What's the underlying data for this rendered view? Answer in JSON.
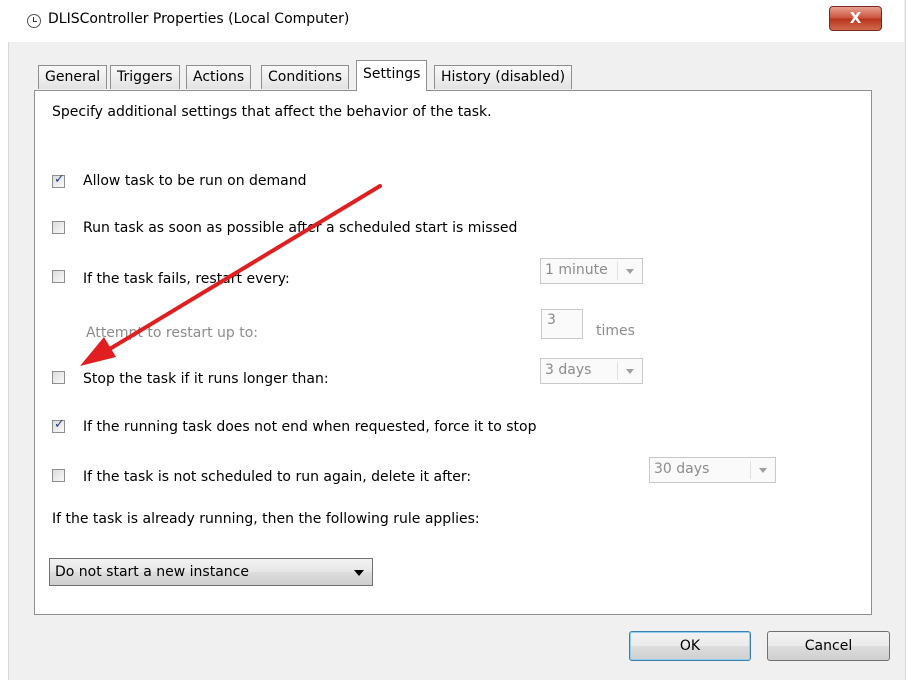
{
  "window": {
    "title": "DLISController Properties (Local Computer)",
    "close_label": "X"
  },
  "tabs": [
    {
      "label": "General"
    },
    {
      "label": "Triggers"
    },
    {
      "label": "Actions"
    },
    {
      "label": "Conditions"
    },
    {
      "label": "Settings",
      "active": true
    },
    {
      "label": "History (disabled)"
    }
  ],
  "settings": {
    "description": "Specify additional settings that affect the behavior of the task.",
    "allow_on_demand": {
      "label": "Allow task to be run on demand",
      "checked": true
    },
    "run_asap": {
      "label": "Run task as soon as possible after a scheduled start is missed",
      "checked": false
    },
    "restart_on_fail": {
      "label": "If the task fails, restart every:",
      "checked": false,
      "value": "1 minute"
    },
    "attempt_restart": {
      "label": "Attempt to restart up to:",
      "value": "3",
      "unit": "times"
    },
    "stop_if_longer": {
      "label": "Stop the task if it runs longer than:",
      "checked": false,
      "value": "3 days"
    },
    "force_stop": {
      "label": "If the running task does not end when requested, force it to stop",
      "checked": true
    },
    "delete_after": {
      "label": "If the task is not scheduled to run again, delete it after:",
      "checked": false,
      "value": "30 days"
    },
    "rule_label": "If the task is already running, then the following rule applies:",
    "rule_value": "Do not start a new instance"
  },
  "buttons": {
    "ok": "OK",
    "cancel": "Cancel"
  },
  "annotation": {
    "arrow_color": "#e02020"
  }
}
